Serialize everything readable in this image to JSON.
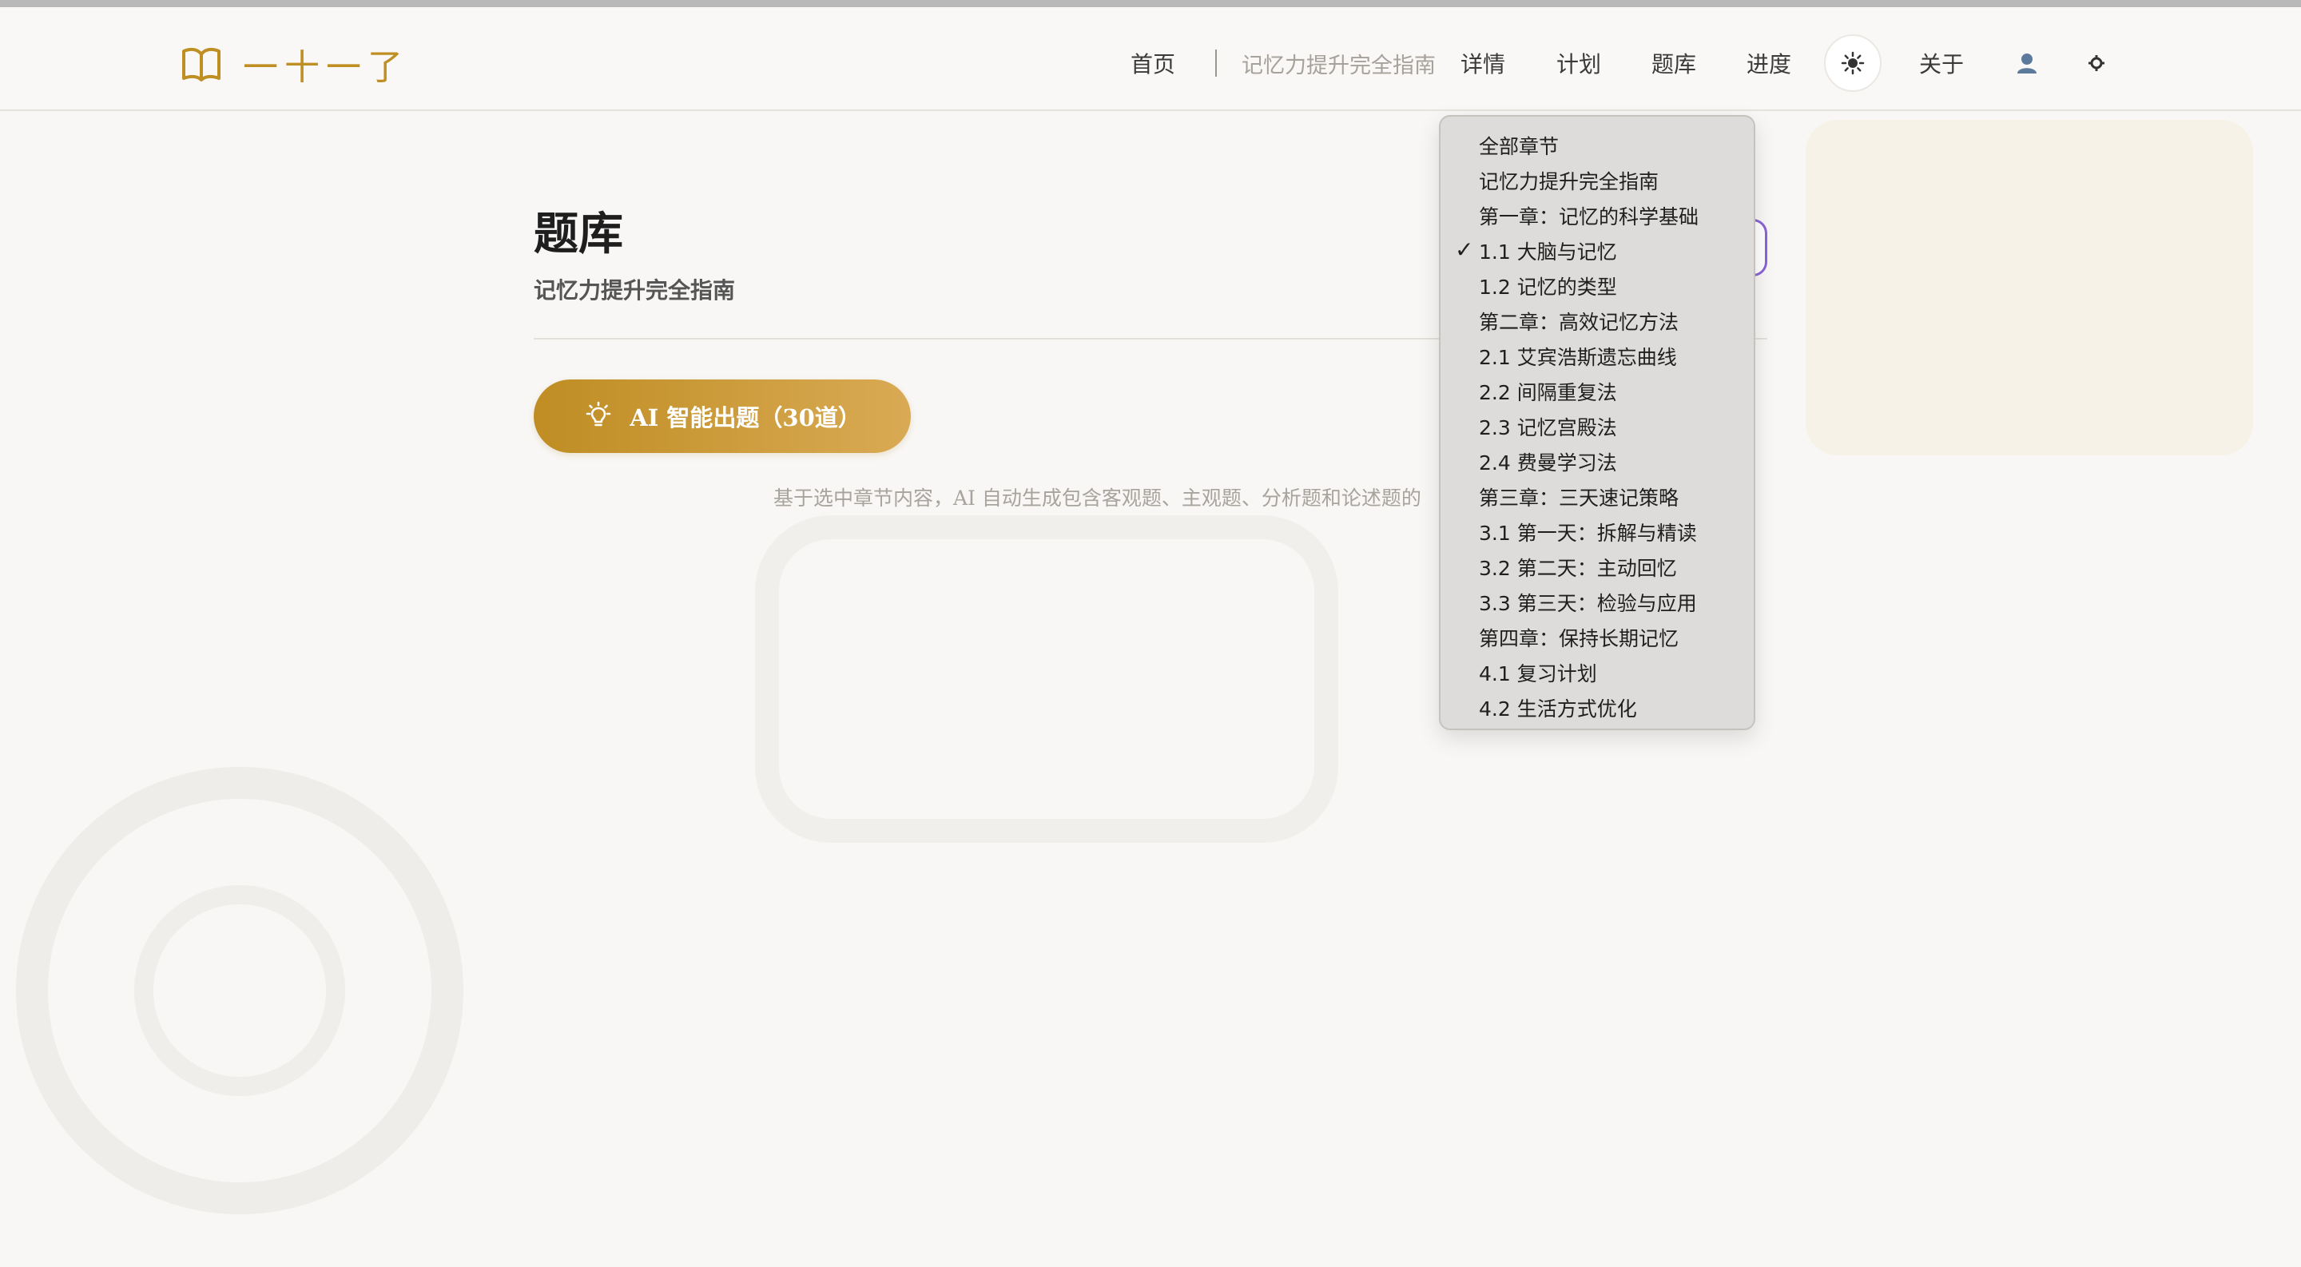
{
  "brand": {
    "logo_icon": "open-book-icon",
    "name": "一十一了",
    "accent_color": "#c08f23"
  },
  "nav": {
    "home": "首页",
    "current_book": "记忆力提升完全指南",
    "details": "详情",
    "plan": "计划",
    "question_bank": "题库",
    "progress": "进度",
    "theme_icon": "sun-icon",
    "about": "关于",
    "user_icon": "user-icon",
    "settings_icon": "gear-icon"
  },
  "page": {
    "title": "题库",
    "subtitle": "记忆力提升完全指南"
  },
  "ai_button": {
    "icon": "lightbulb-icon",
    "label": "AI 智能出题（30道）",
    "gradient": [
      "#bf8d23",
      "#d9aa54"
    ]
  },
  "hint": "基于选中章节内容，AI 自动生成包含客观题、主观题、分析题和论述题的",
  "chapter_select": {
    "selected": "1.1 大脑与记忆",
    "options": [
      {
        "label": "全部章节",
        "checked": false
      },
      {
        "label": "记忆力提升完全指南",
        "checked": false
      },
      {
        "label": "第一章：记忆的科学基础",
        "checked": false
      },
      {
        "label": "1.1 大脑与记忆",
        "checked": true
      },
      {
        "label": "1.2 记忆的类型",
        "checked": false
      },
      {
        "label": "第二章：高效记忆方法",
        "checked": false
      },
      {
        "label": "2.1 艾宾浩斯遗忘曲线",
        "checked": false
      },
      {
        "label": "2.2 间隔重复法",
        "checked": false
      },
      {
        "label": "2.3 记忆宫殿法",
        "checked": false
      },
      {
        "label": "2.4 费曼学习法",
        "checked": false
      },
      {
        "label": "第三章：三天速记策略",
        "checked": false
      },
      {
        "label": "3.1 第一天：拆解与精读",
        "checked": false
      },
      {
        "label": "3.2 第二天：主动回忆",
        "checked": false
      },
      {
        "label": "3.3 第三天：检验与应用",
        "checked": false
      },
      {
        "label": "第四章：保持长期记忆",
        "checked": false
      },
      {
        "label": "4.1 复习计划",
        "checked": false
      },
      {
        "label": "4.2 生活方式优化",
        "checked": false
      }
    ]
  }
}
